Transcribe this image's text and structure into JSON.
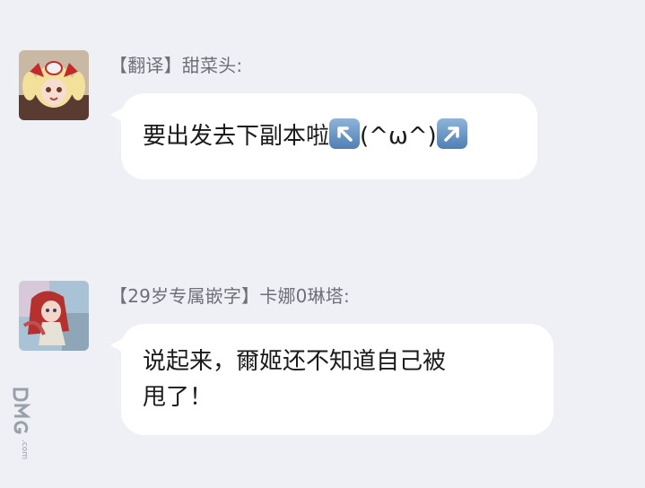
{
  "messages": [
    {
      "sender": "【翻译】甜菜头:",
      "text_before": "要出发去下副本啦",
      "emoji_left": "up-left-arrow",
      "text_middle": "(^ω^)",
      "emoji_right": "up-right-arrow"
    },
    {
      "sender": "【29岁专属嵌字】卡娜0琳塔:",
      "line1": "说起来，爾姬还不知道自己被",
      "line2": "甩了！"
    }
  ],
  "watermark": {
    "text": "DMG",
    "subtext": ".com"
  }
}
